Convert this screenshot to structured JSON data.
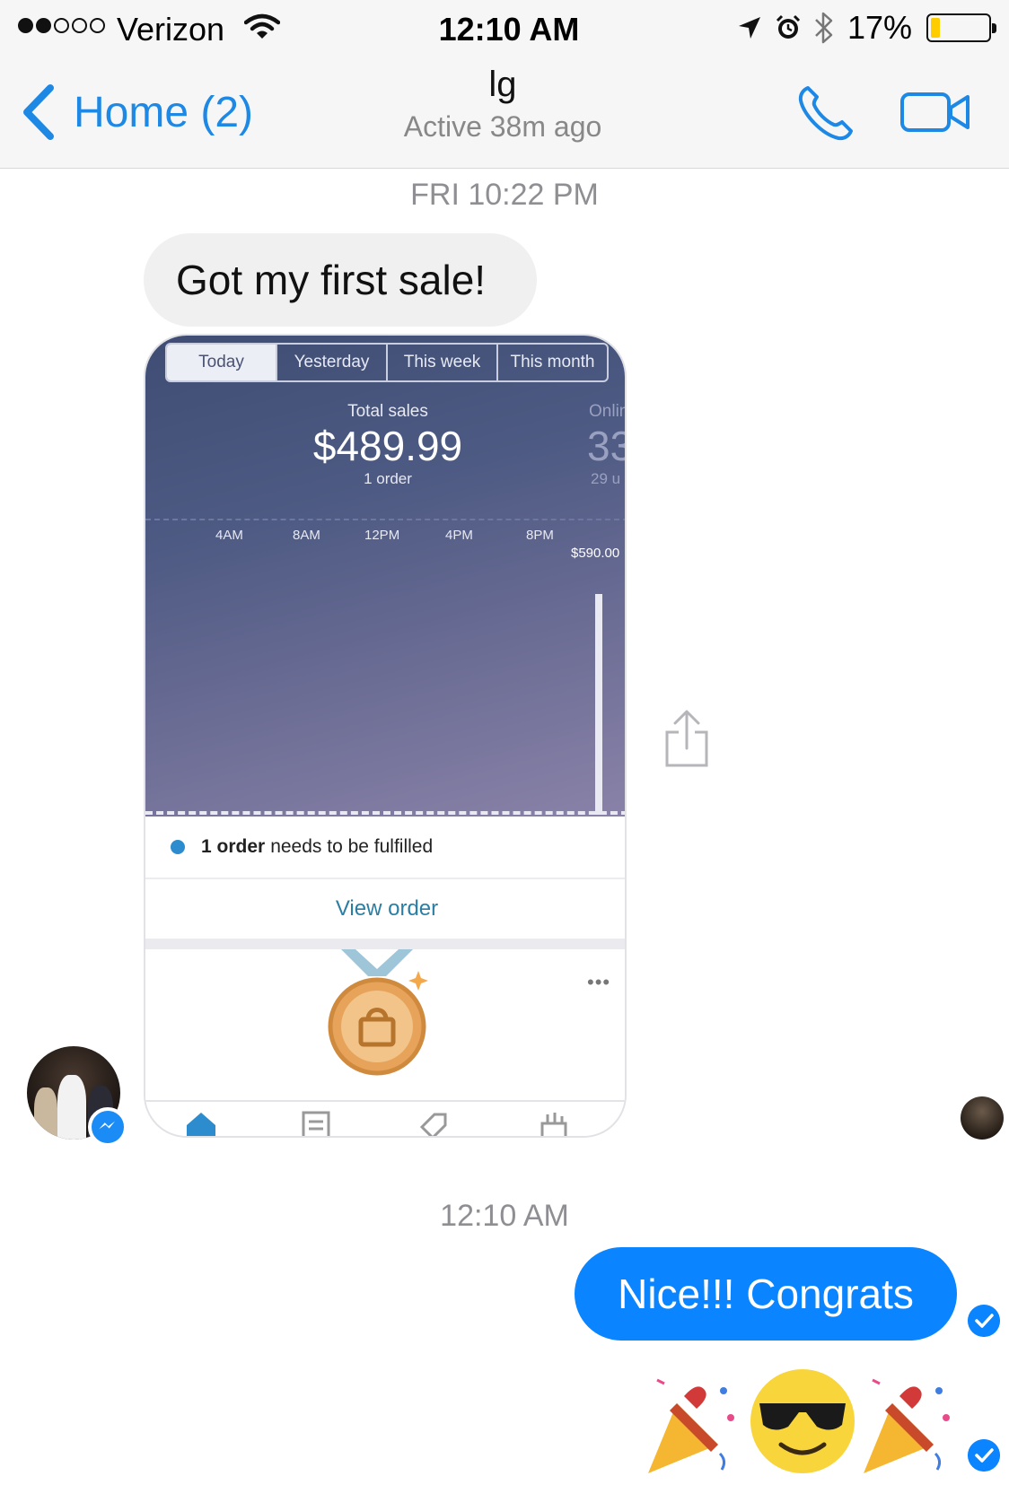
{
  "status_bar": {
    "carrier": "Verizon",
    "time": "12:10 AM",
    "battery_percent": "17%",
    "battery_level": 0.17,
    "signal_bars": 2,
    "signal_total": 5,
    "icons": [
      "wifi-icon",
      "location-arrow-icon",
      "alarm-icon",
      "bluetooth-icon",
      "battery-icon"
    ]
  },
  "header": {
    "back_label": "Home (2)",
    "contact_name": "lg",
    "contact_status": "Active 38m ago",
    "icons": [
      "back-chevron-icon",
      "phone-call-icon",
      "video-call-icon"
    ]
  },
  "conversation": {
    "timestamp_1": "FRI 10:22 PM",
    "incoming_message": "Got my first sale!",
    "timestamp_2": "12:10 AM",
    "outgoing_message": "Nice!!! Congrats",
    "outgoing_emoji": [
      "party-popper-emoji",
      "sunglasses-face-emoji",
      "party-popper-emoji"
    ]
  },
  "attachment": {
    "tabs": [
      "Today",
      "Yesterday",
      "This week",
      "This month"
    ],
    "selected_tab": "Today",
    "total_sales_label": "Total sales",
    "total_sales_value": "$489.99",
    "orders_count": "1 order",
    "online_label_partial": "Onlin",
    "online_value_partial": "33",
    "online_sub_partial": "29 u",
    "axis_ticks": [
      "4AM",
      "8AM",
      "12PM",
      "4PM",
      "8PM"
    ],
    "max_label": "$590.00",
    "fulfil_bold": "1 order",
    "fulfil_rest": "needs to be fulfilled",
    "view_order_label": "View order",
    "more_label": "•••",
    "colors": {
      "header_gradient_start": "#3f4d74",
      "header_gradient_end": "#8a82a8",
      "link": "#2b7ea3",
      "dot": "#2d8ccd"
    }
  },
  "colors": {
    "ios_blue": "#1e88e5",
    "outgoing_bubble": "#0a84ff",
    "incoming_bubble": "#f1f0f0",
    "timestamp": "#8e8e93"
  }
}
